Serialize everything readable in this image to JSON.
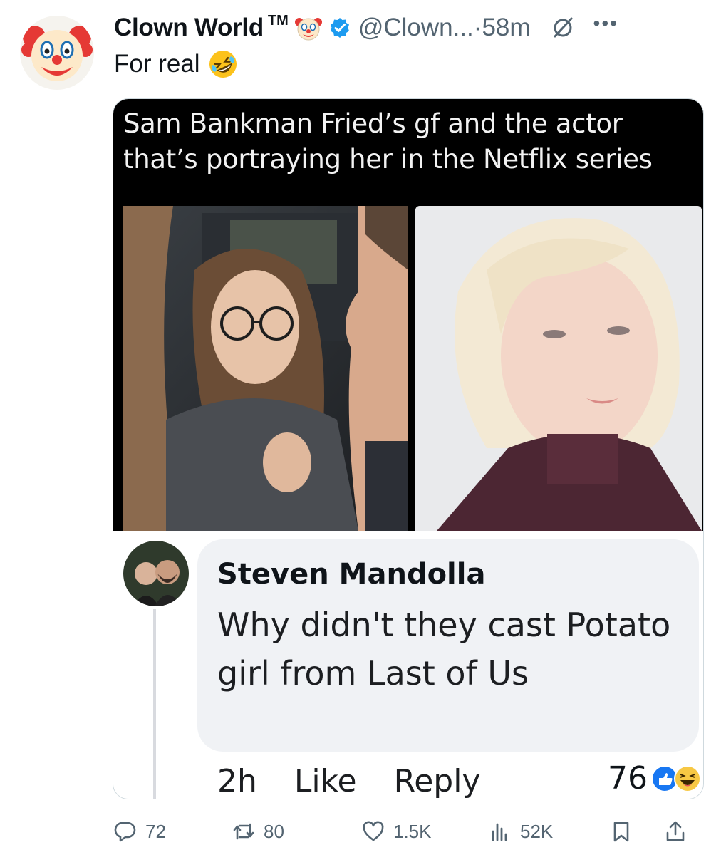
{
  "author": {
    "name": "Clown World ™",
    "tm": "TM",
    "handle": "@Clown...",
    "separator": "·",
    "time": "58m",
    "avatar_icon": "clown-face-emoji",
    "verified_color": "#1d9bf0"
  },
  "tweet": {
    "text": "For real",
    "emoji": "rolling-on-floor-laughing"
  },
  "meme": {
    "caption": "Sam Bankman Fried’s gf and the actor that’s portraying her in the Netflix series",
    "comment": {
      "author": "Steven Mandolla",
      "text": "Why didn't they cast Potato girl from Last of Us",
      "time": "2h",
      "like_label": "Like",
      "reply_label": "Reply",
      "reaction_count": "76"
    }
  },
  "actions": {
    "replies": "72",
    "reposts": "80",
    "likes": "1.5K",
    "views": "52K"
  },
  "colors": {
    "secondary_text": "#536471",
    "fb_bubble": "#f0f2f5",
    "like_blue": "#1877f2"
  }
}
